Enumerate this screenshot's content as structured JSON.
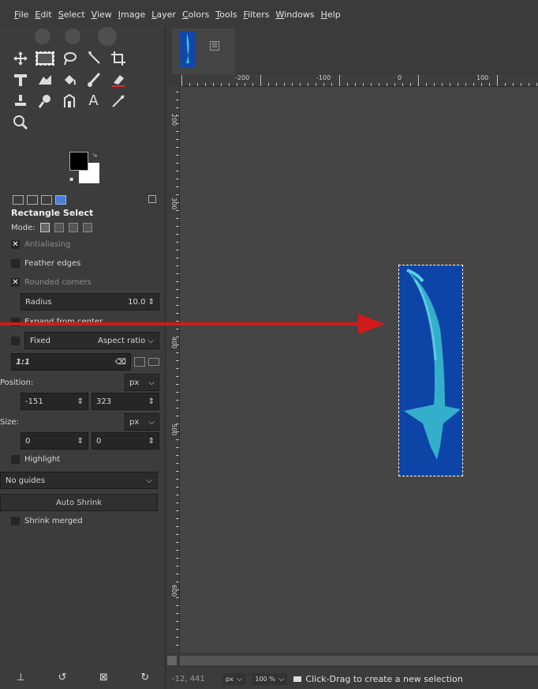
{
  "menubar": {
    "items": [
      "File",
      "Edit",
      "Select",
      "View",
      "Image",
      "Layer",
      "Colors",
      "Tools",
      "Filters",
      "Windows",
      "Help"
    ]
  },
  "toolbox": {
    "tools": [
      "move-icon",
      "rect-select-icon",
      "free-select-icon",
      "fuzzy-select-icon",
      "crop-icon",
      "unified-transform-icon",
      "warp-icon",
      "bucket-fill-icon",
      "paintbrush-icon",
      "eraser-icon",
      "clone-icon",
      "smudge-icon",
      "paths-icon",
      "text-icon",
      "color-picker-icon",
      "zoom-icon"
    ],
    "text_tool_glyph": "A"
  },
  "tool_options": {
    "title": "Rectangle Select",
    "mode_label": "Mode:",
    "antialiasing": "Antialiasing",
    "feather_edges": "Feather edges",
    "rounded_corners": "Rounded corners",
    "radius_label": "Radius",
    "radius_value": "10.0",
    "expand_from_center": "Expand from center",
    "fixed_label": "Fixed",
    "aspect_ratio": "Aspect ratio",
    "ratio_value": "1:1",
    "position_label": "Position:",
    "position_unit": "px",
    "position_x": "-151",
    "position_y": "323",
    "size_label": "Size:",
    "size_unit": "px",
    "size_w": "0",
    "size_h": "0",
    "highlight": "Highlight",
    "guides": "No guides",
    "auto_shrink": "Auto Shrink",
    "shrink_merged": "Shrink merged"
  },
  "rulers": {
    "h_labels": [
      "-200",
      "-100",
      "0",
      "100"
    ],
    "v_labels": [
      "200",
      "300",
      "400",
      "500",
      "600"
    ]
  },
  "statusbar": {
    "coords": "-12, 441",
    "unit": "px",
    "zoom": "100 %",
    "message": "Click-Drag to create a new selection"
  },
  "colors": {
    "annotation_arrow": "#d11a1a",
    "image_bg": "#0d44a8",
    "shark": "#38b8d0"
  }
}
